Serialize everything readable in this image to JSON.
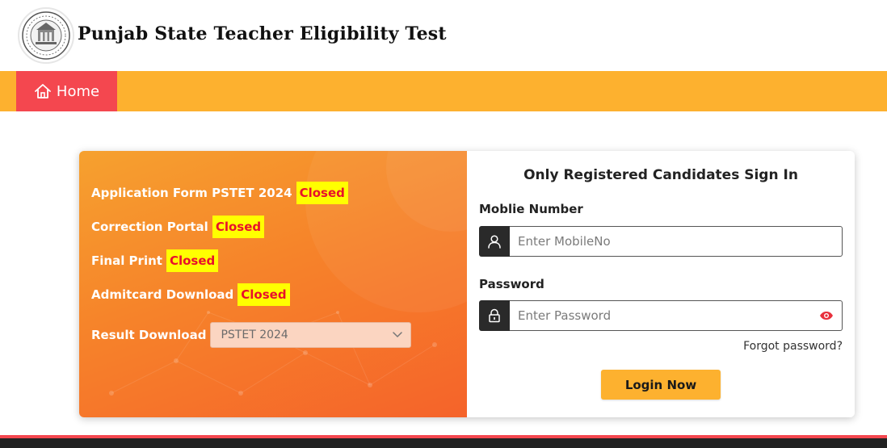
{
  "header": {
    "site_title": "Punjab State Teacher Eligibility Test",
    "logo_icon": "state-emblem-seal-icon"
  },
  "nav": {
    "home_label": "Home",
    "home_icon": "home-icon"
  },
  "status_panel": {
    "items": [
      {
        "label": "Application Form PSTET 2024",
        "status": "Closed"
      },
      {
        "label": "Correction Portal",
        "status": "Closed"
      },
      {
        "label": "Final Print",
        "status": "Closed"
      },
      {
        "label": "Admitcard Download",
        "status": "Closed"
      }
    ],
    "result_label": "Result Download",
    "result_select_value": "PSTET 2024"
  },
  "signin": {
    "title": "Only Registered Candidates Sign In",
    "mobile_label": "Moblie Number",
    "mobile_placeholder": "Enter MobileNo",
    "password_label": "Password",
    "password_placeholder": "Enter Password",
    "forgot_label": "Forgot password?",
    "login_label": "Login Now"
  },
  "colors": {
    "accent_yellow": "#fdb12f",
    "nav_home_red": "#f4474f",
    "badge_yellow": "#ffff00",
    "badge_text_red": "#e8102c",
    "panel_orange": "#f6832a",
    "eye_icon_red": "#e8303c"
  }
}
